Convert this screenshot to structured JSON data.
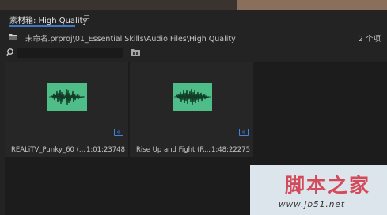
{
  "panel": {
    "title": "素材箱: High Quality",
    "menu_icon": "hamburger-menu-icon",
    "path": "未命名.prproj\\01_Essential Skills\\Audio Files\\High Quality",
    "item_count": "2 个项",
    "search_placeholder": "",
    "accent_color": "#3c77c8"
  },
  "items": [
    {
      "name": "REALiTV_Punky_60 (...",
      "duration": "1:01:23748",
      "thumb_color": "#4fbd87",
      "badge_icon": "audio-clip-icon"
    },
    {
      "name": "Rise Up and Fight (R...",
      "duration": "1:48:22275",
      "thumb_color": "#4fbd87",
      "badge_icon": "audio-clip-icon"
    }
  ],
  "watermark": {
    "big": "脚本之家",
    "small": "www.jb51.net"
  }
}
